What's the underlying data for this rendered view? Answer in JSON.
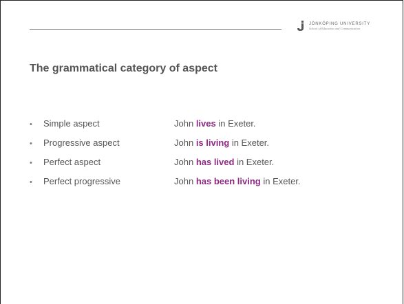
{
  "logo": {
    "name": "JÖNKÖPING UNIVERSITY",
    "subtitle": "School of Education and Communication",
    "icon": "university-logo-icon"
  },
  "title": "The grammatical category of aspect",
  "colors": {
    "text": "#555555",
    "highlight": "#8e2a83",
    "rule": "#7a7a7a"
  },
  "items": [
    {
      "bullet": "•",
      "label": "Simple aspect",
      "pre": "John ",
      "verb": "lives",
      "post": " in Exeter."
    },
    {
      "bullet": "•",
      "label": "Progressive aspect",
      "pre": "John ",
      "verb": "is living",
      "post": " in Exeter."
    },
    {
      "bullet": "•",
      "label": "Perfect aspect",
      "pre": "John ",
      "verb": "has lived",
      "post": " in Exeter."
    },
    {
      "bullet": "•",
      "label": "Perfect progressive",
      "pre": "John ",
      "verb": "has been living",
      "post": " in Exeter."
    }
  ]
}
